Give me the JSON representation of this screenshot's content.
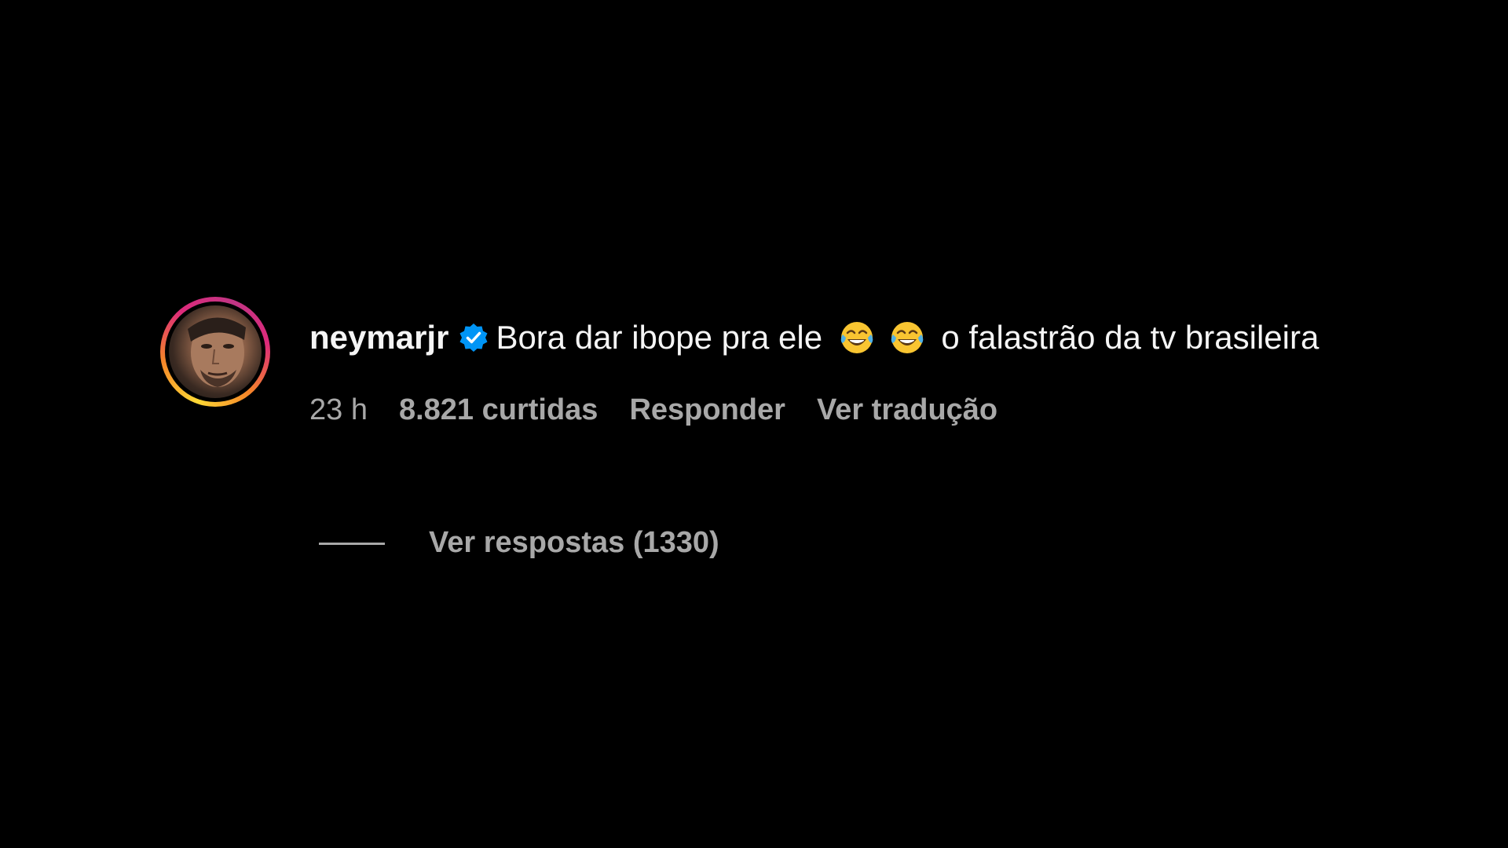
{
  "comment": {
    "username": "neymarjr",
    "verified": true,
    "text_before_emojis": "Bora dar ibope pra ele",
    "emojis": [
      "face-with-tears-of-joy-icon",
      "face-with-tears-of-joy-icon"
    ],
    "text_after_emojis": "o falastrão da tv brasileira",
    "time": "23 h",
    "likes": "8.821 curtidas",
    "reply_label": "Responder",
    "translate_label": "Ver tradução",
    "view_replies_label": "Ver respostas (1330)"
  },
  "colors": {
    "background": "#000000",
    "primary_text": "#f5f5f5",
    "secondary_text": "#a8a8a8",
    "verified_badge": "#0095f6"
  }
}
